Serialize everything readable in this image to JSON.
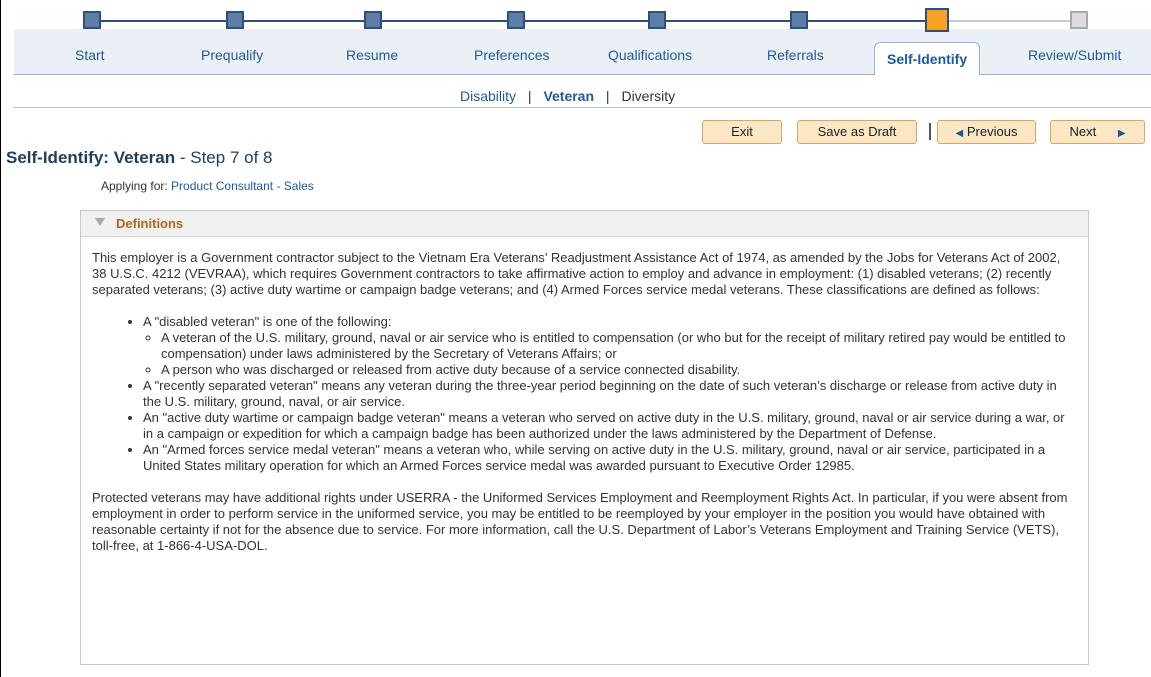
{
  "train": {
    "steps": [
      {
        "label": "Start",
        "state": "done"
      },
      {
        "label": "Prequalify",
        "state": "done"
      },
      {
        "label": "Resume",
        "state": "done"
      },
      {
        "label": "Preferences",
        "state": "done"
      },
      {
        "label": "Qualifications",
        "state": "done"
      },
      {
        "label": "Referrals",
        "state": "done"
      },
      {
        "label": "Self-Identify",
        "state": "current"
      },
      {
        "label": "Review/Submit",
        "state": "todo"
      }
    ]
  },
  "subnav": {
    "items": [
      "Disability",
      "Veteran",
      "Diversity"
    ],
    "separator": "|"
  },
  "buttons": {
    "exit": "Exit",
    "save_draft": "Save as Draft",
    "previous": "Previous",
    "next": "Next",
    "prev_arrow": "◀",
    "next_arrow": "▶"
  },
  "page": {
    "title_prefix": "Self-Identify:",
    "title_main": "Veteran",
    "title_step": "- Step 7 of 8",
    "applying_label": "Applying for:",
    "applying_job": "Product Consultant - Sales"
  },
  "definitions": {
    "header": "Definitions",
    "intro": "This employer is a Government contractor subject to the Vietnam Era Veterans’ Readjustment Assistance Act of 1974, as amended by the Jobs for Veterans Act of 2002, 38 U.S.C. 4212 (VEVRAA), which requires Government contractors to take affirmative action to employ and advance in employment: (1) disabled veterans; (2) recently separated veterans; (3) active duty wartime or campaign badge veterans; and (4) Armed Forces service medal veterans. These classifications are defined as follows:",
    "disabled_intro": "A \"disabled veteran\" is one of the following:",
    "disabled_a": "A veteran of the U.S. military, ground, naval or air service who is entitled to compensation (or who but for the receipt of military retired pay would be entitled to compensation) under laws administered by the Secretary of Veterans Affairs; or",
    "disabled_b": "A person who was discharged or released from active duty because of a service connected disability.",
    "recently": "A \"recently separated veteran\" means any veteran during the three-year period beginning on the date of such veteran’s discharge or release from active duty in the U.S. military, ground, naval, or air service.",
    "active_duty": "An \"active duty wartime or campaign badge veteran\" means a veteran who served on active duty in the U.S. military, ground, naval or air service during a war, or in a campaign or expedition for which a campaign badge has been authorized under the laws administered by the Department of Defense.",
    "armed_forces": "An \"Armed forces service medal veteran\" means a veteran who, while serving on active duty in the U.S. military, ground, naval or air service, participated in a United States military operation for which an Armed Forces service medal was awarded pursuant to Executive Order 12985.",
    "closing": "Protected veterans may have additional rights under USERRA - the Uniformed Services Employment and Reemployment Rights Act. In particular, if you were absent from employment in order to perform service in the uniformed service, you may be entitled to be reemployed by your employer in the position you would have obtained with reasonable certainty if not for the absence due to service. For more information, call the U.S. Department of Labor’s Veterans Employment and Training Service (VETS), toll-free, at 1-866-4-USA-DOL."
  }
}
